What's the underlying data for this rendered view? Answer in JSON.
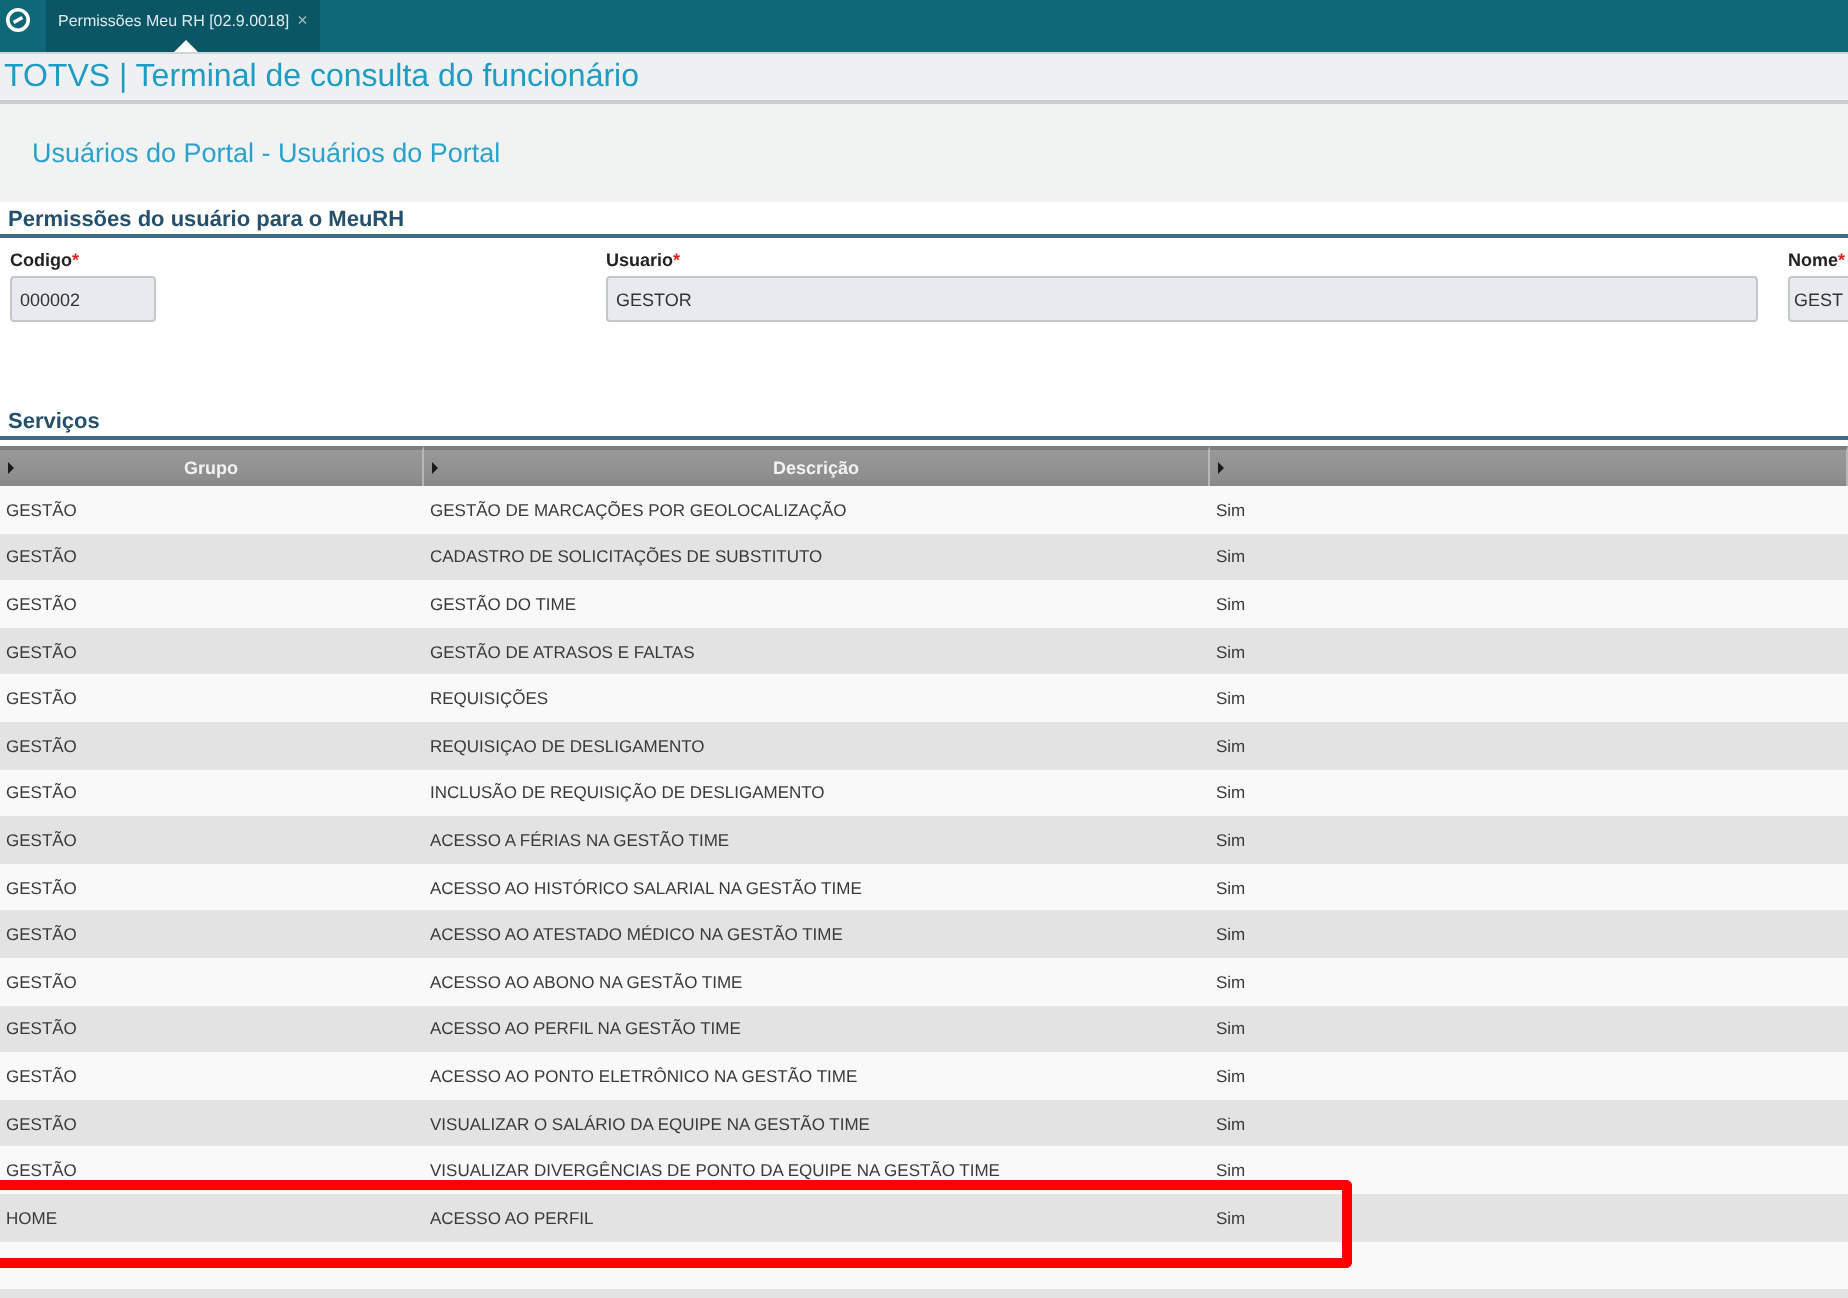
{
  "tabs": [
    {
      "label": "Permissões Meu RH [02.9.0018]",
      "close": "×",
      "selected": true
    }
  ],
  "app_title": "TOTVS | Terminal de consulta do funcionário",
  "page_title": "Usuários do Portal - Usuários do Portal",
  "form": {
    "title": "Permissões do usuário para o MeuRH",
    "required_mark": "*",
    "fields": [
      {
        "label": "Codigo",
        "required": true,
        "value": "000002"
      },
      {
        "label": "Usuario",
        "required": true,
        "value": "GESTOR"
      },
      {
        "label": "Nome",
        "required": true,
        "value": "GEST"
      }
    ]
  },
  "services": {
    "title": "Serviços",
    "columns": [
      "Grupo",
      "Descrição"
    ],
    "rows": [
      {
        "cells": [
          "GESTÃO",
          "GESTÃO DE MARCAÇÕES POR GEOLOCALIZAÇÃO",
          "Sim"
        ],
        "highlighted": false
      },
      {
        "cells": [
          "GESTÃO",
          "CADASTRO DE SOLICITAÇÕES DE SUBSTITUTO",
          "Sim"
        ],
        "highlighted": false
      },
      {
        "cells": [
          "GESTÃO",
          "GESTÃO DO TIME",
          "Sim"
        ],
        "highlighted": false
      },
      {
        "cells": [
          "GESTÃO",
          "GESTÃO DE ATRASOS E FALTAS",
          "Sim"
        ],
        "highlighted": false
      },
      {
        "cells": [
          "GESTÃO",
          "REQUISIÇÕES",
          "Sim"
        ],
        "highlighted": false
      },
      {
        "cells": [
          "GESTÃO",
          "REQUISIÇAO DE DESLIGAMENTO",
          "Sim"
        ],
        "highlighted": false
      },
      {
        "cells": [
          "GESTÃO",
          "INCLUSÃO DE REQUISIÇÃO DE DESLIGAMENTO",
          "Sim"
        ],
        "highlighted": false
      },
      {
        "cells": [
          "GESTÃO",
          "ACESSO A FÉRIAS NA GESTÃO TIME",
          "Sim"
        ],
        "highlighted": false
      },
      {
        "cells": [
          "GESTÃO",
          "ACESSO AO HISTÓRICO SALARIAL NA GESTÃO TIME",
          "Sim"
        ],
        "highlighted": false
      },
      {
        "cells": [
          "GESTÃO",
          "ACESSO AO ATESTADO MÉDICO NA GESTÃO TIME",
          "Sim"
        ],
        "highlighted": false
      },
      {
        "cells": [
          "GESTÃO",
          "ACESSO AO ABONO NA GESTÃO TIME",
          "Sim"
        ],
        "highlighted": false
      },
      {
        "cells": [
          "GESTÃO",
          "ACESSO AO PERFIL NA GESTÃO TIME",
          "Sim"
        ],
        "highlighted": false
      },
      {
        "cells": [
          "GESTÃO",
          "ACESSO AO PONTO ELETRÔNICO NA GESTÃO TIME",
          "Sim"
        ],
        "highlighted": false
      },
      {
        "cells": [
          "GESTÃO",
          "VISUALIZAR O SALÁRIO DA EQUIPE NA GESTÃO TIME",
          "Sim"
        ],
        "highlighted": false
      },
      {
        "cells": [
          "GESTÃO",
          "VISUALIZAR DIVERGÊNCIAS DE PONTO DA EQUIPE NA GESTÃO TIME",
          "Sim"
        ],
        "highlighted": false
      },
      {
        "cells": [
          "HOME",
          "ACESSO AO PERFIL",
          "Sim"
        ],
        "highlighted": true
      }
    ]
  }
}
